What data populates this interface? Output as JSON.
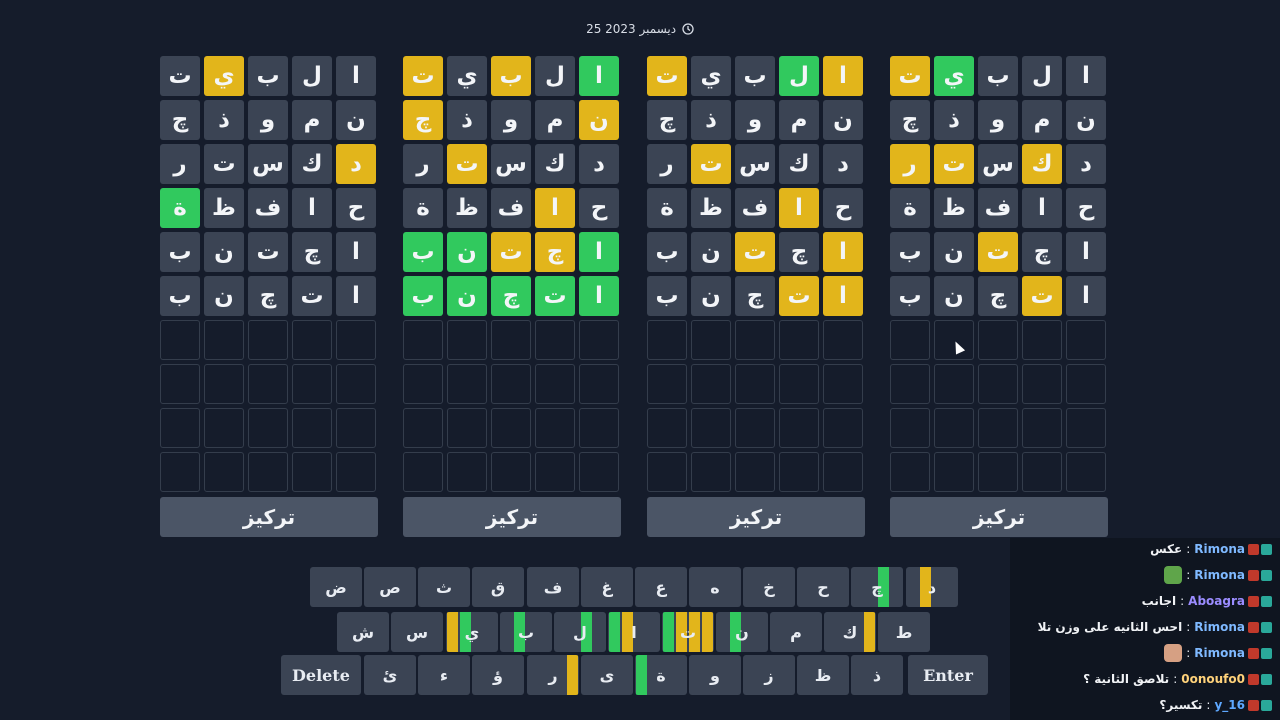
{
  "date": "25 ديسمبر 2023",
  "colors": {
    "present": "#e2b51b",
    "correct": "#31c95e",
    "absent": "#3b4454",
    "background": "#151c2b"
  },
  "focus_label": "تركيز",
  "boards": [
    {
      "rows": [
        {
          "letters": [
            "ت",
            "ي",
            "ب",
            "ل",
            "ا"
          ],
          "states": [
            "n",
            "y",
            "n",
            "n",
            "n"
          ]
        },
        {
          "letters": [
            "چ",
            "ذ",
            "و",
            "م",
            "ن"
          ],
          "states": [
            "n",
            "n",
            "n",
            "n",
            "n"
          ]
        },
        {
          "letters": [
            "ر",
            "ت",
            "س",
            "ك",
            "د"
          ],
          "states": [
            "n",
            "n",
            "n",
            "n",
            "y"
          ]
        },
        {
          "letters": [
            "ة",
            "ظ",
            "ف",
            "ا",
            "ح"
          ],
          "states": [
            "g",
            "n",
            "n",
            "n",
            "n"
          ]
        },
        {
          "letters": [
            "ب",
            "ن",
            "ت",
            "چ",
            "ا"
          ],
          "states": [
            "n",
            "n",
            "n",
            "n",
            "n"
          ]
        },
        {
          "letters": [
            "ب",
            "ن",
            "چ",
            "ت",
            "ا"
          ],
          "states": [
            "n",
            "n",
            "n",
            "n",
            "n"
          ]
        }
      ]
    },
    {
      "rows": [
        {
          "letters": [
            "ت",
            "ي",
            "ب",
            "ل",
            "ا"
          ],
          "states": [
            "y",
            "n",
            "y",
            "n",
            "g"
          ]
        },
        {
          "letters": [
            "چ",
            "ذ",
            "و",
            "م",
            "ن"
          ],
          "states": [
            "y",
            "n",
            "n",
            "n",
            "y"
          ]
        },
        {
          "letters": [
            "ر",
            "ت",
            "س",
            "ك",
            "د"
          ],
          "states": [
            "n",
            "y",
            "n",
            "n",
            "n"
          ]
        },
        {
          "letters": [
            "ة",
            "ظ",
            "ف",
            "ا",
            "ح"
          ],
          "states": [
            "n",
            "n",
            "n",
            "y",
            "n"
          ]
        },
        {
          "letters": [
            "ب",
            "ن",
            "ت",
            "چ",
            "ا"
          ],
          "states": [
            "g",
            "g",
            "y",
            "y",
            "g"
          ]
        },
        {
          "letters": [
            "ب",
            "ن",
            "چ",
            "ت",
            "ا"
          ],
          "states": [
            "g",
            "g",
            "g",
            "g",
            "g"
          ]
        }
      ]
    },
    {
      "rows": [
        {
          "letters": [
            "ت",
            "ي",
            "ب",
            "ل",
            "ا"
          ],
          "states": [
            "y",
            "n",
            "n",
            "g",
            "y"
          ]
        },
        {
          "letters": [
            "چ",
            "ذ",
            "و",
            "م",
            "ن"
          ],
          "states": [
            "n",
            "n",
            "n",
            "n",
            "n"
          ]
        },
        {
          "letters": [
            "ر",
            "ت",
            "س",
            "ك",
            "د"
          ],
          "states": [
            "n",
            "y",
            "n",
            "n",
            "n"
          ]
        },
        {
          "letters": [
            "ة",
            "ظ",
            "ف",
            "ا",
            "ح"
          ],
          "states": [
            "n",
            "n",
            "n",
            "y",
            "n"
          ]
        },
        {
          "letters": [
            "ب",
            "ن",
            "ت",
            "چ",
            "ا"
          ],
          "states": [
            "n",
            "n",
            "y",
            "n",
            "y"
          ]
        },
        {
          "letters": [
            "ب",
            "ن",
            "چ",
            "ت",
            "ا"
          ],
          "states": [
            "n",
            "n",
            "n",
            "y",
            "y"
          ]
        }
      ]
    },
    {
      "rows": [
        {
          "letters": [
            "ت",
            "ي",
            "ب",
            "ل",
            "ا"
          ],
          "states": [
            "y",
            "g",
            "n",
            "n",
            "n"
          ]
        },
        {
          "letters": [
            "چ",
            "ذ",
            "و",
            "م",
            "ن"
          ],
          "states": [
            "n",
            "n",
            "n",
            "n",
            "n"
          ]
        },
        {
          "letters": [
            "ر",
            "ت",
            "س",
            "ك",
            "د"
          ],
          "states": [
            "y",
            "y",
            "n",
            "y",
            "n"
          ]
        },
        {
          "letters": [
            "ة",
            "ظ",
            "ف",
            "ا",
            "ح"
          ],
          "states": [
            "n",
            "n",
            "n",
            "n",
            "n"
          ]
        },
        {
          "letters": [
            "ب",
            "ن",
            "ت",
            "چ",
            "ا"
          ],
          "states": [
            "n",
            "n",
            "y",
            "n",
            "n"
          ]
        },
        {
          "letters": [
            "ب",
            "ن",
            "چ",
            "ت",
            "ا"
          ],
          "states": [
            "n",
            "n",
            "n",
            "y",
            "n"
          ]
        }
      ]
    }
  ],
  "keyboard": {
    "rows": [
      [
        {
          "label": "ض",
          "marks": []
        },
        {
          "label": "ص",
          "marks": []
        },
        {
          "label": "ث",
          "marks": []
        },
        {
          "label": "ق",
          "marks": []
        },
        {
          "label": "ف",
          "marks": []
        },
        {
          "label": "غ",
          "marks": []
        },
        {
          "label": "ع",
          "marks": []
        },
        {
          "label": "ه",
          "marks": []
        },
        {
          "label": "خ",
          "marks": []
        },
        {
          "label": "ح",
          "marks": []
        },
        {
          "label": "چ",
          "marks": [
            "",
            "",
            "g",
            ""
          ]
        },
        {
          "label": "د",
          "marks": [
            "",
            "y",
            "",
            ""
          ]
        }
      ],
      [
        {
          "label": "ش",
          "marks": []
        },
        {
          "label": "س",
          "marks": []
        },
        {
          "label": "ي",
          "marks": [
            "y",
            "g",
            "",
            ""
          ]
        },
        {
          "label": "ب",
          "marks": [
            "",
            "g",
            "",
            ""
          ]
        },
        {
          "label": "ل",
          "marks": [
            "",
            "",
            "g",
            ""
          ]
        },
        {
          "label": "ا",
          "marks": [
            "g",
            "y",
            "",
            ""
          ]
        },
        {
          "label": "ت",
          "marks": [
            "g",
            "y",
            "y",
            "y"
          ]
        },
        {
          "label": "ن",
          "marks": [
            "",
            "g",
            "",
            ""
          ]
        },
        {
          "label": "م",
          "marks": []
        },
        {
          "label": "ك",
          "marks": [
            "",
            "",
            "",
            "y"
          ]
        },
        {
          "label": "ط",
          "marks": []
        }
      ],
      [
        {
          "label": "Delete",
          "marks": [],
          "wide": true
        },
        {
          "label": "ئ",
          "marks": []
        },
        {
          "label": "ء",
          "marks": []
        },
        {
          "label": "ؤ",
          "marks": []
        },
        {
          "label": "ر",
          "marks": [
            "",
            "",
            "",
            "y"
          ]
        },
        {
          "label": "ى",
          "marks": []
        },
        {
          "label": "ة",
          "marks": [
            "g",
            "",
            "",
            ""
          ]
        },
        {
          "label": "و",
          "marks": []
        },
        {
          "label": "ز",
          "marks": []
        },
        {
          "label": "ظ",
          "marks": []
        },
        {
          "label": "ذ",
          "marks": []
        },
        {
          "label": "Enter",
          "marks": [],
          "wide": true
        }
      ]
    ]
  },
  "chat": [
    {
      "user": "Rimona",
      "user_color": "#7fb9ff",
      "text": "عكس",
      "emote": ""
    },
    {
      "user": "Rimona",
      "user_color": "#7fb9ff",
      "text": "",
      "emote": "frog"
    },
    {
      "user": "Aboagra",
      "user_color": "#9b8cff",
      "text": "اجانب",
      "emote": ""
    },
    {
      "user": "Rimona",
      "user_color": "#7fb9ff",
      "text": "احس الثانيه على وزن تلا",
      "emote": ""
    },
    {
      "user": "Rimona",
      "user_color": "#7fb9ff",
      "text": "",
      "emote": "face"
    },
    {
      "user": "0onoufo0",
      "user_color": "#ffd27a",
      "text": "تلاصق الثانية ؟",
      "emote": ""
    },
    {
      "user": "y_16",
      "user_color": "#5ea8ff",
      "text": "تكسير؟",
      "emote": ""
    }
  ]
}
